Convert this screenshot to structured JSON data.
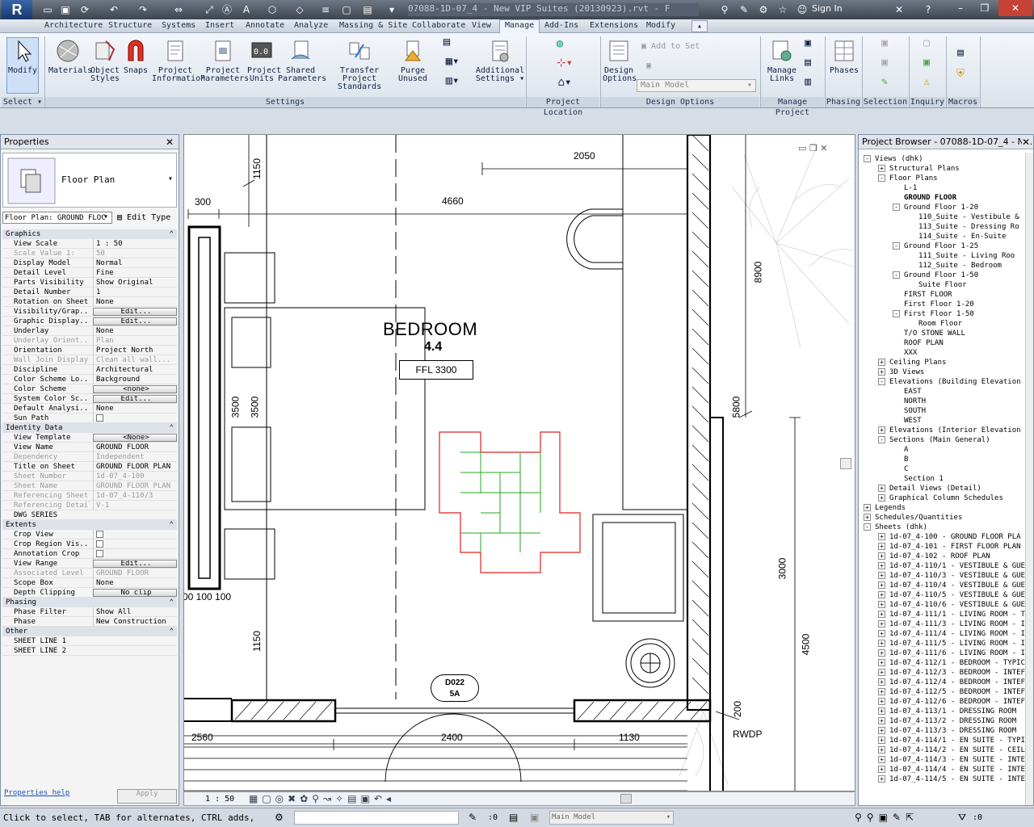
{
  "app": {
    "logo": "R",
    "doc_title": "07088-1D-07_4 - New VIP Suites (20130923).rvt - F",
    "sign_in": "Sign In"
  },
  "tabs": [
    "Architecture",
    "Structure",
    "Systems",
    "Insert",
    "Annotate",
    "Analyze",
    "Massing & Site",
    "Collaborate",
    "View",
    "Manage",
    "Add-Ins",
    "Extensions",
    "Modify"
  ],
  "active_tab": "Manage",
  "ribbon": {
    "modify": "Modify",
    "select": "Select",
    "materials": "Materials",
    "object_styles": [
      "Object",
      "Styles"
    ],
    "snaps": "Snaps",
    "project_information": [
      "Project",
      "Information"
    ],
    "project_parameters": [
      "Project",
      "Parameters"
    ],
    "project_units": [
      "Project",
      "Units"
    ],
    "shared_parameters": [
      "Shared",
      "Parameters"
    ],
    "transfer_project_standards": [
      "Transfer",
      "Project Standards"
    ],
    "purge_unused": [
      "Purge",
      "Unused"
    ],
    "additional_settings": [
      "Additional",
      "Settings"
    ],
    "design_options": [
      "Design",
      "Options"
    ],
    "add_to_set": "Add to Set",
    "main_model": "Main Model",
    "manage_links": [
      "Manage",
      "Links"
    ],
    "phases": "Phases",
    "panels": {
      "select": "Select",
      "settings": "Settings",
      "project_location": "Project Location",
      "design_options": "Design Options",
      "manage_project": "Manage Project",
      "phasing": "Phasing",
      "selection": "Selection",
      "inquiry": "Inquiry",
      "macros": "Macros"
    }
  },
  "properties": {
    "title": "Properties",
    "type_name": "Floor Plan",
    "instance": "Floor Plan: GROUND FLOC",
    "edit_type": "Edit Type",
    "groups": {
      "graphics": "Graphics",
      "identity": "Identity Data",
      "extents": "Extents",
      "phasing": "Phasing",
      "other": "Other"
    },
    "graphics": [
      {
        "k": "View Scale",
        "v": "1 : 50"
      },
      {
        "k": "Scale Value  1:",
        "v": "50",
        "dim": true
      },
      {
        "k": "Display Model",
        "v": "Normal"
      },
      {
        "k": "Detail Level",
        "v": "Fine"
      },
      {
        "k": "Parts Visibility",
        "v": "Show Original"
      },
      {
        "k": "Detail Number",
        "v": "1"
      },
      {
        "k": "Rotation on Sheet",
        "v": "None"
      },
      {
        "k": "Visibility/Grap...",
        "v": "Edit...",
        "btn": true
      },
      {
        "k": "Graphic Display...",
        "v": "Edit...",
        "btn": true
      },
      {
        "k": "Underlay",
        "v": "None"
      },
      {
        "k": "Underlay Orient...",
        "v": "Plan",
        "dim": true
      },
      {
        "k": "Orientation",
        "v": "Project North"
      },
      {
        "k": "Wall Join Display",
        "v": "Clean all wall...",
        "dim": true
      },
      {
        "k": "Discipline",
        "v": "Architectural"
      },
      {
        "k": "Color Scheme Lo...",
        "v": "Background"
      },
      {
        "k": "Color Scheme",
        "v": "<none>",
        "btn": true
      },
      {
        "k": "System Color Sc...",
        "v": "Edit...",
        "btn": true
      },
      {
        "k": "Default Analysi...",
        "v": "None"
      },
      {
        "k": "Sun Path",
        "v": ""
      }
    ],
    "identity": [
      {
        "k": "View Template",
        "v": "<None>",
        "btn": true
      },
      {
        "k": "View Name",
        "v": "GROUND FLOOR"
      },
      {
        "k": "Dependency",
        "v": "Independent",
        "dim": true
      },
      {
        "k": "Title on Sheet",
        "v": "GROUND FLOOR PLAN"
      },
      {
        "k": "Sheet Number",
        "v": "1d-07_4-100",
        "dim": true
      },
      {
        "k": "Sheet Name",
        "v": "GROUND FLOOR PLAN",
        "dim": true
      },
      {
        "k": "Referencing Sheet",
        "v": "1d-07_4-110/3",
        "dim": true
      },
      {
        "k": "Referencing Detail",
        "v": "V-1",
        "dim": true
      },
      {
        "k": "DWG SERIES",
        "v": ""
      }
    ],
    "extents": [
      {
        "k": "Crop View",
        "v": ""
      },
      {
        "k": "Crop Region Vis...",
        "v": ""
      },
      {
        "k": "Annotation Crop",
        "v": ""
      },
      {
        "k": "View Range",
        "v": "Edit...",
        "btn": true
      },
      {
        "k": "Associated Level",
        "v": "GROUND FLOOR",
        "dim": true
      },
      {
        "k": "Scope Box",
        "v": "None"
      },
      {
        "k": "Depth Clipping",
        "v": "No clip",
        "btn": true
      }
    ],
    "phasing": [
      {
        "k": "Phase Filter",
        "v": "Show All"
      },
      {
        "k": "Phase",
        "v": "New Construction"
      }
    ],
    "other": [
      {
        "k": "SHEET LINE 1",
        "v": ""
      },
      {
        "k": "SHEET LINE 2",
        "v": ""
      }
    ],
    "help": "Properties help",
    "apply": "Apply"
  },
  "drawing": {
    "room_name": "BEDROOM",
    "room_number": "4.4",
    "ffl": "FFL 3300",
    "door_tag": "D022",
    "door_type": "5A",
    "rwdp": "RWDP",
    "dims": {
      "d2050": "2050",
      "d1150a": "1150",
      "d300": "300",
      "d4660": "4660",
      "d8900": "8900",
      "d3500a": "3500",
      "d3500b": "3500",
      "d5800": "5800",
      "d100": "00 100 100",
      "d1150b": "1150",
      "d3000": "3000",
      "d4500": "4500",
      "d200": "200",
      "d2560": "2560",
      "d2400": "2400",
      "d1130": "1130"
    }
  },
  "viewbar": {
    "scale": "1 : 50"
  },
  "browser": {
    "title": "Project Browser - 07088-1D-07_4 - N...",
    "items": [
      {
        "t": "Views (dhk)",
        "l": 0,
        "e": "-"
      },
      {
        "t": "Structural Plans",
        "l": 1,
        "e": "+"
      },
      {
        "t": "Floor Plans",
        "l": 1,
        "e": "-"
      },
      {
        "t": "L-1",
        "l": 2
      },
      {
        "t": "GROUND FLOOR",
        "l": 2,
        "b": true
      },
      {
        "t": "Ground Floor 1-20",
        "l": 2,
        "e": "-"
      },
      {
        "t": "110_Suite - Vestibule &",
        "l": 3
      },
      {
        "t": "113_Suite - Dressing Ro",
        "l": 3
      },
      {
        "t": "114_Suite - En-Suite",
        "l": 3
      },
      {
        "t": "Ground Floor 1-25",
        "l": 2,
        "e": "-"
      },
      {
        "t": "111_Suite - Living Roo",
        "l": 3
      },
      {
        "t": "112_Suite - Bedroom",
        "l": 3
      },
      {
        "t": "Ground Floor 1-50",
        "l": 2,
        "e": "-"
      },
      {
        "t": "Suite Floor",
        "l": 3
      },
      {
        "t": "FIRST FLOOR",
        "l": 2
      },
      {
        "t": "First Floor 1-20",
        "l": 2
      },
      {
        "t": "First Floor 1-50",
        "l": 2,
        "e": "-"
      },
      {
        "t": "Room Floor",
        "l": 3
      },
      {
        "t": "T/O STONE WALL",
        "l": 2
      },
      {
        "t": "ROOF PLAN",
        "l": 2
      },
      {
        "t": "XXX",
        "l": 2
      },
      {
        "t": "Ceiling Plans",
        "l": 1,
        "e": "+"
      },
      {
        "t": "3D Views",
        "l": 1,
        "e": "+"
      },
      {
        "t": "Elevations (Building Elevation",
        "l": 1,
        "e": "-"
      },
      {
        "t": "EAST",
        "l": 2
      },
      {
        "t": "NORTH",
        "l": 2
      },
      {
        "t": "SOUTH",
        "l": 2
      },
      {
        "t": "WEST",
        "l": 2
      },
      {
        "t": "Elevations (Interior Elevation",
        "l": 1,
        "e": "+"
      },
      {
        "t": "Sections (Main General)",
        "l": 1,
        "e": "-"
      },
      {
        "t": "A",
        "l": 2
      },
      {
        "t": "B",
        "l": 2
      },
      {
        "t": "C",
        "l": 2
      },
      {
        "t": "Section 1",
        "l": 2
      },
      {
        "t": "Detail Views (Detail)",
        "l": 1,
        "e": "+"
      },
      {
        "t": "Graphical Column Schedules",
        "l": 1,
        "e": "+"
      },
      {
        "t": "Legends",
        "l": 0,
        "e": "+"
      },
      {
        "t": "Schedules/Quantities",
        "l": 0,
        "e": "+"
      },
      {
        "t": "Sheets (dhk)",
        "l": 0,
        "e": "-"
      },
      {
        "t": "1d-07_4-100 - GROUND FLOOR PLA",
        "l": 1,
        "e": "+"
      },
      {
        "t": "1d-07_4-101 - FIRST FLOOR PLAN",
        "l": 1,
        "e": "+"
      },
      {
        "t": "1d-07_4-102 - ROOF PLAN",
        "l": 1,
        "e": "+"
      },
      {
        "t": "1d-07_4-110/1 - VESTIBULE & GUE",
        "l": 1,
        "e": "+"
      },
      {
        "t": "1d-07_4-110/3 - VESTIBULE & GUE",
        "l": 1,
        "e": "+"
      },
      {
        "t": "1d-07_4-110/4 - VESTIBULE & GUE",
        "l": 1,
        "e": "+"
      },
      {
        "t": "1d-07_4-110/5 - VESTIBULE & GUE",
        "l": 1,
        "e": "+"
      },
      {
        "t": "1d-07_4-110/6 - VESTIBULE & GUE",
        "l": 1,
        "e": "+"
      },
      {
        "t": "1d-07_4-111/1 - LIVING ROOM - T",
        "l": 1,
        "e": "+"
      },
      {
        "t": "1d-07_4-111/3 - LIVING ROOM - I",
        "l": 1,
        "e": "+"
      },
      {
        "t": "1d-07_4-111/4 - LIVING ROOM - I",
        "l": 1,
        "e": "+"
      },
      {
        "t": "1d-07_4-111/5 - LIVING ROOM - I",
        "l": 1,
        "e": "+"
      },
      {
        "t": "1d-07_4-111/6 - LIVING ROOM - I",
        "l": 1,
        "e": "+"
      },
      {
        "t": "1d-07_4-112/1 - BEDROOM - TYPIC",
        "l": 1,
        "e": "+"
      },
      {
        "t": "1d-07_4-112/3 - BEDROOM - INTEF",
        "l": 1,
        "e": "+"
      },
      {
        "t": "1d-07_4-112/4 - BEDROOM - INTEF",
        "l": 1,
        "e": "+"
      },
      {
        "t": "1d-07_4-112/5 - BEDROOM - INTEF",
        "l": 1,
        "e": "+"
      },
      {
        "t": "1d-07_4-112/6 - BEDROOM - INTEF",
        "l": 1,
        "e": "+"
      },
      {
        "t": "1d-07_4-113/1 - DRESSING ROOM",
        "l": 1,
        "e": "+"
      },
      {
        "t": "1d-07_4-113/2 - DRESSING ROOM",
        "l": 1,
        "e": "+"
      },
      {
        "t": "1d-07_4-113/3 - DRESSING ROOM",
        "l": 1,
        "e": "+"
      },
      {
        "t": "1d-07_4-114/1 - EN SUITE - TYPI",
        "l": 1,
        "e": "+"
      },
      {
        "t": "1d-07_4-114/2 - EN SUITE - CEIL",
        "l": 1,
        "e": "+"
      },
      {
        "t": "1d-07_4-114/3 - EN SUITE - INTE",
        "l": 1,
        "e": "+"
      },
      {
        "t": "1d-07_4-114/4 - EN SUITE - INTE",
        "l": 1,
        "e": "+"
      },
      {
        "t": "1d-07_4-114/5 - EN SUITE - INTE",
        "l": 1,
        "e": "+"
      }
    ]
  },
  "status": {
    "hint": "Click to select, TAB for alternates, CTRL adds,",
    "count": ":0",
    "model": "Main Model",
    "filter_count": ":0"
  }
}
